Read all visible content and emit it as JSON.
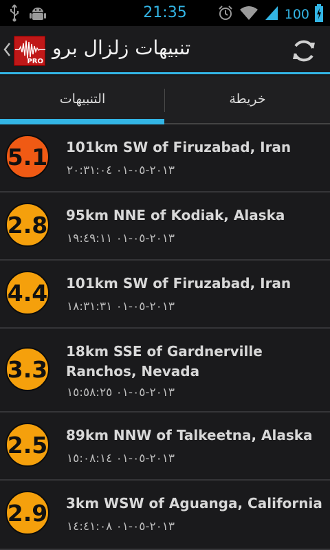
{
  "status_bar": {
    "time": "21:35",
    "battery_percent": "100",
    "icons_left": [
      "usb-icon",
      "android-debug-icon"
    ],
    "icons_right": [
      "alarm-icon",
      "wifi-icon",
      "signal-icon",
      "battery-charging-icon"
    ]
  },
  "action_bar": {
    "title": "تنبيهات زلزال برو",
    "logo_badge": "PRO",
    "refresh_icon": "refresh-icon",
    "up_icon": "chevron-left-icon"
  },
  "tabs": [
    {
      "label": "التنبيهات",
      "selected": true
    },
    {
      "label": "خريطة",
      "selected": false
    }
  ],
  "colors": {
    "accent": "#33b5e5",
    "magnitude_high": "#f05a14",
    "magnitude_low": "#f5a00c"
  },
  "alerts": [
    {
      "magnitude": "5.1",
      "place": "101km SW of Firuzabad, Iran",
      "datetime": "٢٠١٣-٠٥-٠١ ٢٠:٣١:٠٤",
      "color": "#f05a14"
    },
    {
      "magnitude": "2.8",
      "place": "95km NNE of Kodiak, Alaska",
      "datetime": "٢٠١٣-٠٥-٠١ ١٩:٤٩:١١",
      "color": "#f5a00c"
    },
    {
      "magnitude": "4.4",
      "place": "101km SW of Firuzabad, Iran",
      "datetime": "٢٠١٣-٠٥-٠١ ١٨:٣١:٣١",
      "color": "#f5a00c"
    },
    {
      "magnitude": "3.3",
      "place": "18km SSE of Gardnerville Ranchos, Nevada",
      "datetime": "٢٠١٣-٠٥-٠١ ١٥:٥٨:٢٥",
      "color": "#f5a00c"
    },
    {
      "magnitude": "2.5",
      "place": "89km NNW of Talkeetna, Alaska",
      "datetime": "٢٠١٣-٠٥-٠١ ١٥:٠٨:١٤",
      "color": "#f5a00c"
    },
    {
      "magnitude": "2.9",
      "place": "3km WSW of Aguanga, California",
      "datetime": "٢٠١٣-٠٥-٠١ ١٤:٤١:٠٨",
      "color": "#f5a00c"
    }
  ]
}
